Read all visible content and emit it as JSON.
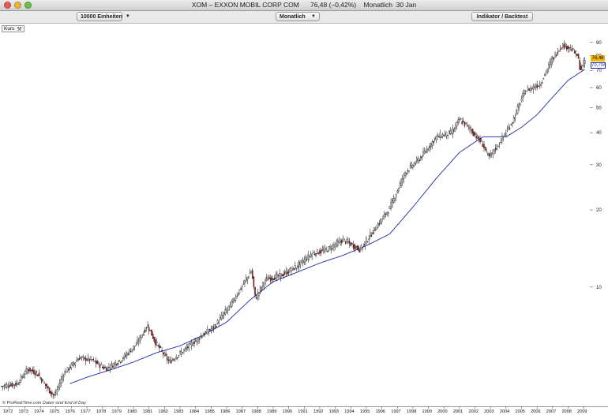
{
  "window": {
    "title": "XOM – EXXON MOBIL CORP COM      76,48 (–0,42%)    Monatlich  30 Jan"
  },
  "toolbar": {
    "units_label": "10000 Einheiten",
    "period_label": "Monatlich",
    "indicator_label": "Indikator / Backtest"
  },
  "panel": {
    "label": "Kurs"
  },
  "footer": {
    "copyright": "© ProRealTime.com",
    "disclaimer": "Daten sind End of Day"
  },
  "badges": {
    "price": "76,48",
    "ma": "70,704"
  },
  "colors": {
    "up_candle": "#ffffff",
    "down_candle": "#cc1f1f",
    "candle_outline": "#000000",
    "moving_average": "#1d2aa8",
    "price_badge": "#f0b800"
  },
  "chart_data": {
    "type": "line",
    "scale": "log",
    "ylim": [
      3.5,
      105
    ],
    "xlim": [
      1971.5,
      2009.3
    ],
    "y_ticks": [
      10,
      20,
      30,
      40,
      50,
      60,
      70,
      80,
      90
    ],
    "y_tick_labels": [
      "10",
      "20",
      "30",
      "40",
      "50",
      "60",
      "70",
      "80",
      "90"
    ],
    "x_ticks": [
      1972,
      1973,
      1974,
      1975,
      1976,
      1977,
      1978,
      1979,
      1980,
      1981,
      1982,
      1983,
      1984,
      1985,
      1986,
      1987,
      1988,
      1989,
      1990,
      1991,
      1992,
      1993,
      1994,
      1995,
      1996,
      1997,
      1998,
      1999,
      2000,
      2001,
      2002,
      2003,
      2004,
      2005,
      2006,
      2007,
      2008,
      2009
    ],
    "x_tick_labels": [
      "1972",
      "1973",
      "1974",
      "1975",
      "1976",
      "1977",
      "1978",
      "1979",
      "1980",
      "1981",
      "1982",
      "1983",
      "1984",
      "1985",
      "1986",
      "1987",
      "1988",
      "1989",
      "1990",
      "1991",
      "1992",
      "1993",
      "1994",
      "1995",
      "1996",
      "1997",
      "1998",
      "1999",
      "2000",
      "2001",
      "2002",
      "2003",
      "2004",
      "2005",
      "2006",
      "2007",
      "2008",
      "2009"
    ],
    "price_anchors": [
      [
        1971.5,
        4.1
      ],
      [
        1972.5,
        4.2
      ],
      [
        1973.2,
        4.8
      ],
      [
        1973.8,
        4.6
      ],
      [
        1974.5,
        4.0
      ],
      [
        1974.9,
        3.75
      ],
      [
        1975.5,
        4.6
      ],
      [
        1976.5,
        5.3
      ],
      [
        1977.3,
        5.2
      ],
      [
        1978.2,
        4.8
      ],
      [
        1979.2,
        5.2
      ],
      [
        1980.2,
        6.0
      ],
      [
        1980.9,
        7.1
      ],
      [
        1981.4,
        6.1
      ],
      [
        1982.3,
        5.1
      ],
      [
        1983.3,
        5.7
      ],
      [
        1984.3,
        6.4
      ],
      [
        1985.2,
        7.0
      ],
      [
        1986.3,
        8.6
      ],
      [
        1987.6,
        11.6
      ],
      [
        1987.85,
        9.0
      ],
      [
        1988.5,
        10.7
      ],
      [
        1989.5,
        11.1
      ],
      [
        1990.5,
        12.0
      ],
      [
        1991.5,
        13.5
      ],
      [
        1992.5,
        14.0
      ],
      [
        1993.5,
        15.3
      ],
      [
        1994.6,
        14.0
      ],
      [
        1995.5,
        16.7
      ],
      [
        1996.5,
        20.3
      ],
      [
        1997.5,
        28.0
      ],
      [
        1998.5,
        32.0
      ],
      [
        1999.5,
        38.5
      ],
      [
        2000.5,
        40.0
      ],
      [
        2001.0,
        45.0
      ],
      [
        2001.6,
        42.0
      ],
      [
        2002.5,
        36.0
      ],
      [
        2002.9,
        32.0
      ],
      [
        2003.5,
        36.0
      ],
      [
        2004.4,
        44.0
      ],
      [
        2005.2,
        58.0
      ],
      [
        2006.2,
        62.0
      ],
      [
        2006.9,
        76.0
      ],
      [
        2007.6,
        88.0
      ],
      [
        2008.1,
        86.0
      ],
      [
        2008.6,
        80.0
      ],
      [
        2008.8,
        70.0
      ],
      [
        2009.08,
        76.48
      ]
    ],
    "moving_average_anchors": [
      [
        1975.9,
        4.2
      ],
      [
        1977.0,
        4.45
      ],
      [
        1978.5,
        4.75
      ],
      [
        1980.0,
        5.1
      ],
      [
        1981.5,
        5.55
      ],
      [
        1983.0,
        5.9
      ],
      [
        1984.5,
        6.5
      ],
      [
        1986.0,
        7.3
      ],
      [
        1987.5,
        8.9
      ],
      [
        1989.0,
        10.5
      ],
      [
        1990.5,
        11.4
      ],
      [
        1992.0,
        12.4
      ],
      [
        1993.5,
        13.3
      ],
      [
        1995.0,
        14.5
      ],
      [
        1996.5,
        16.1
      ],
      [
        1998.0,
        20.5
      ],
      [
        1999.5,
        26.5
      ],
      [
        2001.0,
        33.5
      ],
      [
        2002.5,
        38.5
      ],
      [
        2004.0,
        38.5
      ],
      [
        2005.0,
        42.0
      ],
      [
        2006.0,
        47.0
      ],
      [
        2007.0,
        55.0
      ],
      [
        2008.0,
        64.0
      ],
      [
        2009.08,
        70.704
      ]
    ]
  }
}
